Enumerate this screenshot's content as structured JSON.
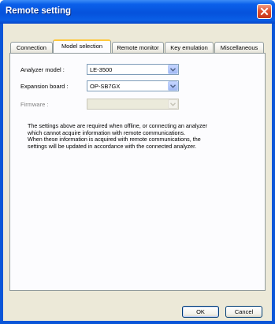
{
  "window": {
    "title": "Remote setting",
    "close_icon": "close-x-icon"
  },
  "tabs": [
    {
      "label": "Connection",
      "active": false
    },
    {
      "label": "Model selection",
      "active": true
    },
    {
      "label": "Remote monitor",
      "active": false
    },
    {
      "label": "Key emulation",
      "active": false
    },
    {
      "label": "Miscellaneous",
      "active": false
    }
  ],
  "form": {
    "analyzer_model": {
      "label": "Analyzer model :",
      "value": "LE-3500",
      "enabled": true
    },
    "expansion_board": {
      "label": "Expansion board :",
      "value": "OP-SB7GX",
      "enabled": true
    },
    "firmware": {
      "label": "Firmware :",
      "value": "",
      "enabled": false
    }
  },
  "note_lines": [
    "The settings above are required when offline, or connecting an analyzer",
    "which cannot acquire information with remote communications.",
    "When these information is acquired with remote communications, the",
    "settings will be updated in accordance with the connected analyzer."
  ],
  "buttons": {
    "ok": "OK",
    "cancel": "Cancel"
  },
  "colors": {
    "titlebar": "#0552dc",
    "client": "#ece9d8",
    "active_tab_accent": "#ffc83c"
  }
}
